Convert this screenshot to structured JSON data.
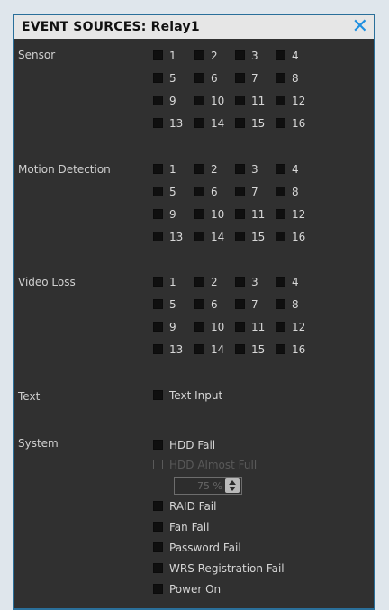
{
  "dialog": {
    "title": "EVENT SOURCES: Relay1",
    "close_icon": "close-icon"
  },
  "sections": {
    "sensor": {
      "label": "Sensor",
      "channels": [
        "1",
        "2",
        "3",
        "4",
        "5",
        "6",
        "7",
        "8",
        "9",
        "10",
        "11",
        "12",
        "13",
        "14",
        "15",
        "16"
      ]
    },
    "motion": {
      "label": "Motion Detection",
      "channels": [
        "1",
        "2",
        "3",
        "4",
        "5",
        "6",
        "7",
        "8",
        "9",
        "10",
        "11",
        "12",
        "13",
        "14",
        "15",
        "16"
      ]
    },
    "video_loss": {
      "label": "Video Loss",
      "channels": [
        "1",
        "2",
        "3",
        "4",
        "5",
        "6",
        "7",
        "8",
        "9",
        "10",
        "11",
        "12",
        "13",
        "14",
        "15",
        "16"
      ]
    },
    "text": {
      "label": "Text",
      "option": "Text Input"
    },
    "system": {
      "label": "System",
      "options": {
        "hdd_fail": "HDD Fail",
        "hdd_almost_full": "HDD Almost Full",
        "raid_fail": "RAID Fail",
        "fan_fail": "Fan Fail",
        "password_fail": "Password Fail",
        "wrs_fail": "WRS Registration Fail",
        "power_on": "Power On"
      },
      "threshold": "75 %"
    }
  }
}
